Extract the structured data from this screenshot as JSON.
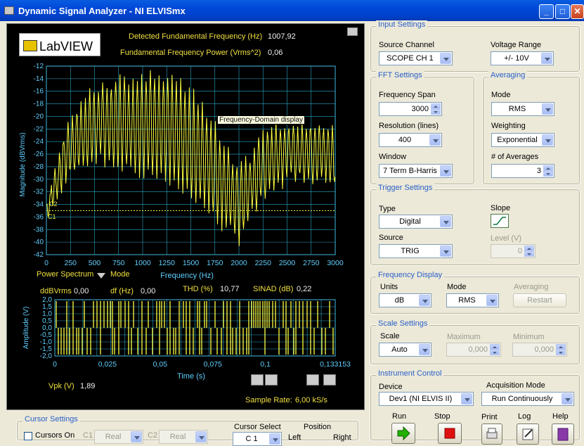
{
  "window": {
    "title": "Dynamic Signal Analyzer - NI ELVISmx",
    "minimize": "_",
    "maximize": "□",
    "close": "✕"
  },
  "branding": {
    "logo_text": "LabVIEW"
  },
  "readouts": {
    "fund_freq_label": "Detected Fundamental Frequency (Hz)",
    "fund_freq_value": "1007,92",
    "fund_power_label": "Fundamental Frequency Power (Vrms^2)",
    "fund_power_value": "0,06",
    "thd_label": "THD (%)",
    "thd_value": "10,77",
    "sinad_label": "SINAD (dB)",
    "sinad_value": "0,22",
    "ddb_label": "ddBVrms",
    "ddb_value": "0,00",
    "df_label": "df (Hz)",
    "df_value": "0,00",
    "vpk_label": "Vpk (V)",
    "vpk_value": "1,89",
    "sample_rate_label": "Sample Rate:",
    "sample_rate_value": "6,00 kS/s"
  },
  "freq_chart": {
    "ylabel": "Magnitude (dBVrms)",
    "xlabel": "Frequency (Hz)",
    "tooltip": "Frequency-Domain display",
    "mode_selector": "Power Spectrum",
    "mode_label": "Mode",
    "cursor1": "C1",
    "cursor2": "C2"
  },
  "time_chart": {
    "ylabel": "Amplitude (V)",
    "xlabel": "Time (s)"
  },
  "chart_data": [
    {
      "type": "line",
      "ylabel": "Magnitude (dBVrms)",
      "xlabel": "Frequency (Hz)",
      "xlim": [
        0,
        3000
      ],
      "ylim": [
        -42,
        -12
      ],
      "x_ticks": [
        0,
        250,
        500,
        750,
        1000,
        1250,
        1500,
        1750,
        2000,
        2250,
        2500,
        2750,
        3000
      ],
      "y_ticks": [
        -12,
        -14,
        -16,
        -18,
        -20,
        -22,
        -24,
        -26,
        -28,
        -30,
        -32,
        -34,
        -36,
        -38,
        -40,
        -42
      ],
      "grid": true,
      "cursor_level": -35,
      "series": [
        {
          "color": "#ffff40",
          "envelope_x": [
            0,
            100,
            200,
            300,
            400,
            500,
            600,
            700,
            800,
            900,
            1000,
            1100,
            1200,
            1300,
            1400,
            1500,
            1600,
            1700,
            1800,
            1900,
            2000,
            2100,
            2200,
            2300,
            2400,
            2500,
            2600,
            2700,
            2800,
            2900,
            3000
          ],
          "upper": [
            -34,
            -28,
            -22,
            -19,
            -17,
            -16,
            -15,
            -14.5,
            -14,
            -14,
            -13.5,
            -13,
            -13.5,
            -14,
            -14.5,
            -16,
            -18,
            -20,
            -23,
            -26,
            -28,
            -27,
            -24,
            -22,
            -21,
            -21,
            -22,
            -21,
            -21,
            -22,
            -22
          ],
          "lower": [
            -36,
            -33,
            -30,
            -29,
            -28,
            -27,
            -27,
            -28,
            -28,
            -29,
            -29,
            -29,
            -30,
            -31,
            -32,
            -33,
            -34,
            -35,
            -37,
            -38,
            -40,
            -36,
            -34,
            -32,
            -31,
            -30,
            -30,
            -30,
            -30,
            -30,
            -31
          ]
        }
      ]
    },
    {
      "type": "line",
      "ylabel": "Amplitude (V)",
      "xlabel": "Time (s)",
      "xlim": [
        0,
        0.133153
      ],
      "ylim": [
        -2,
        2
      ],
      "x_ticks": [
        "0",
        "0,025",
        "0,05",
        "0,075",
        "0,1",
        "0,133153"
      ],
      "y_ticks": [
        "2,0",
        "1,5",
        "1,0",
        "0,5",
        "0,0",
        "-0,5",
        "-1,0",
        "-1,5",
        "-2,0"
      ],
      "grid": true,
      "series": [
        {
          "color": "#ffff40",
          "description_levels": [
            1.9,
            0,
            -1.9
          ]
        }
      ]
    }
  ],
  "input_settings": {
    "title": "Input Settings",
    "source_label": "Source Channel",
    "source_value": "SCOPE CH 1",
    "range_label": "Voltage Range",
    "range_value": "+/- 10V"
  },
  "fft_settings": {
    "title": "FFT Settings",
    "span_label": "Frequency Span",
    "span_value": "3000",
    "res_label": "Resolution (lines)",
    "res_value": "400",
    "window_label": "Window",
    "window_value": "7 Term B-Harris"
  },
  "averaging": {
    "title": "Averaging",
    "mode_label": "Mode",
    "mode_value": "RMS",
    "weight_label": "Weighting",
    "weight_value": "Exponential",
    "num_label": "# of Averages",
    "num_value": "3"
  },
  "trigger": {
    "title": "Trigger Settings",
    "type_label": "Type",
    "type_value": "Digital",
    "slope_label": "Slope",
    "source_label": "Source",
    "source_value": "TRIG",
    "level_label": "Level (V)",
    "level_value": "0"
  },
  "freq_display": {
    "title": "Frequency Display",
    "units_label": "Units",
    "units_value": "dB",
    "mode_label": "Mode",
    "mode_value": "RMS",
    "avg_label": "Averaging",
    "restart_label": "Restart"
  },
  "scale": {
    "title": "Scale Settings",
    "scale_label": "Scale",
    "scale_value": "Auto",
    "max_label": "Maximum",
    "max_value": "0,000",
    "min_label": "Minimum",
    "min_value": "0,000"
  },
  "instrument": {
    "title": "Instrument Control",
    "device_label": "Device",
    "device_value": "Dev1 (NI ELVIS II)",
    "acq_label": "Acquisition Mode",
    "acq_value": "Run Continuously",
    "run_label": "Run",
    "stop_label": "Stop",
    "print_label": "Print",
    "log_label": "Log",
    "help_label": "Help"
  },
  "cursor": {
    "title": "Cursor Settings",
    "cursors_on_label": "Cursors On",
    "c1_label": "C1",
    "c1_value": "Real",
    "c2_label": "C2",
    "c2_value": "Real",
    "select_label": "Cursor Select",
    "select_value": "C 1",
    "position_label": "Position",
    "left_label": "Left",
    "right_label": "Right"
  }
}
